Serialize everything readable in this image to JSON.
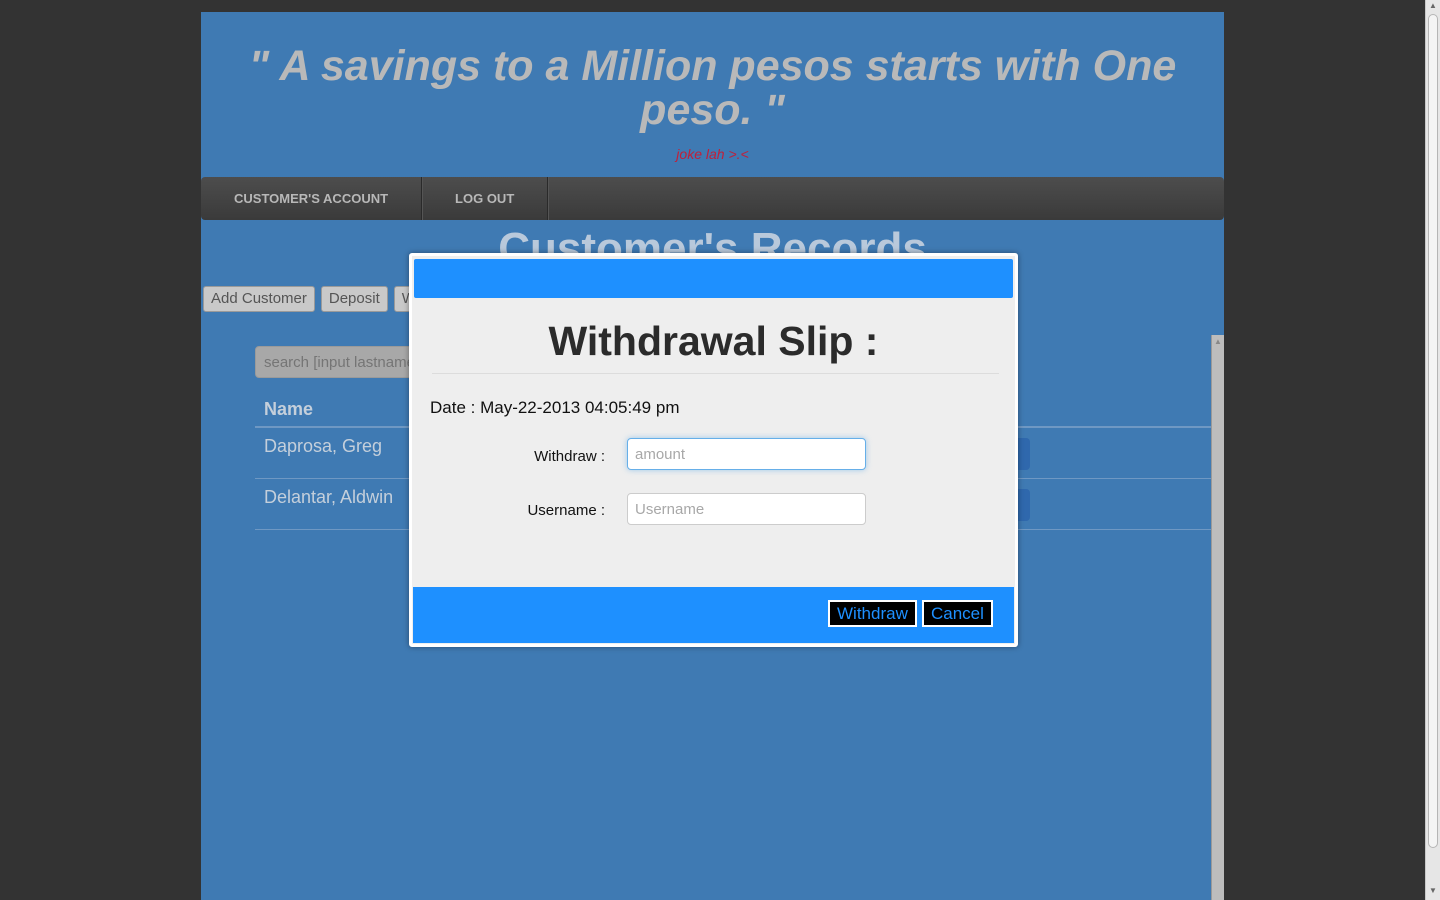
{
  "header": {
    "quote": "\" A savings to a Million pesos starts with One peso. \"",
    "joke": "joke lah >.<"
  },
  "nav": {
    "items": [
      "CUSTOMER'S ACCOUNT",
      "LOG OUT"
    ]
  },
  "records": {
    "title": "Customer's Records",
    "buttons": [
      "Add Customer",
      "Deposit",
      "W"
    ],
    "search_placeholder": "search [input lastname]",
    "column_name": "Name",
    "rows": [
      "Daprosa, Greg",
      "Delantar, Aldwin"
    ]
  },
  "modal": {
    "title": "Withdrawal Slip :",
    "date_label": "Date : May-22-2013 04:05:49 pm",
    "withdraw_label": "Withdraw :",
    "withdraw_placeholder": "amount",
    "username_label": "Username :",
    "username_placeholder": "Username",
    "withdraw_button": "Withdraw",
    "cancel_button": "Cancel"
  },
  "colors": {
    "page_bg": "#3f7ab3",
    "modal_accent": "#1e90ff",
    "outer_bg": "#333333"
  }
}
